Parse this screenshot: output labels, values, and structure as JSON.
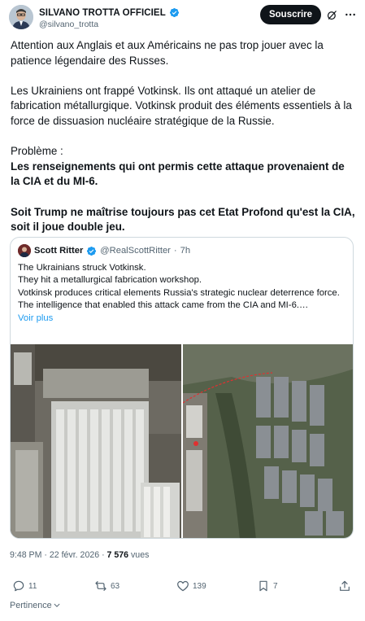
{
  "author": {
    "name": "SILVANO TROTTA OFFICIEL",
    "handle": "@silvano_trotta",
    "verified_color": "#1d9bf0"
  },
  "header": {
    "subscribe_label": "Souscrire",
    "grok_icon": "grok-icon",
    "more_icon": "more-icon"
  },
  "tweet": {
    "p1": "Attention aux Anglais et aux Américains ne pas trop jouer avec la patience légendaire des Russes.",
    "p2": "Les Ukrainiens ont frappé Votkinsk. Ils ont attaqué un atelier de fabrication métallurgique. Votkinsk produit des éléments essentiels à la force de dissuasion nucléaire stratégique de la Russie.",
    "p3_label": "Problème :",
    "p3_bold": "Les renseignements qui ont permis cette attaque provenaient de la CIA et du MI-6.",
    "p4_bold": "Soit Trump ne maîtrise toujours pas cet Etat Profond qu'est la CIA, soit il joue double jeu."
  },
  "quote": {
    "name": "Scott Ritter",
    "handle": "@RealScottRitter",
    "separator": "·",
    "time": "7h",
    "line1": "The Ukrainians struck Votkinsk.",
    "line2": "They hit a metallurgical fabrication workshop.",
    "line3": "Votkinsk produces critical elements Russia's strategic nuclear deterrence force.",
    "line4": "The intelligence that enabled this attack came from the CIA and MI-6.…",
    "show_more": "Voir plus"
  },
  "meta": {
    "timestamp": "9:48 PM · 22 févr. 2026 · ",
    "views_count": "7 576",
    "views_label": " vues"
  },
  "actions": {
    "replies": "11",
    "reposts": "63",
    "likes": "139",
    "bookmarks": "7"
  },
  "sort": {
    "label": "Pertinence"
  },
  "colors": {
    "text": "#0f1419",
    "secondary": "#536471",
    "accent": "#1d9bf0",
    "border": "#cfd9de"
  }
}
